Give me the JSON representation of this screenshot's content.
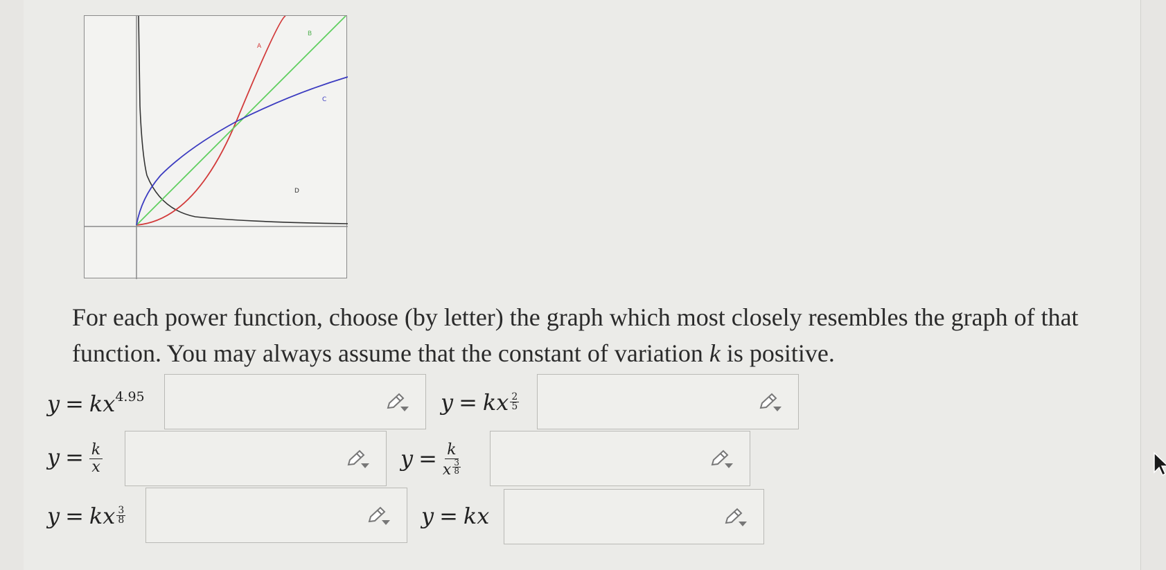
{
  "graph": {
    "curve_labels": [
      "A",
      "B",
      "C",
      "D"
    ],
    "colors": {
      "A": "#d23a3a",
      "B": "#5fcf5f",
      "C": "#3b3bc0",
      "D": "#333333"
    }
  },
  "prompt": {
    "part1": "For each power function, choose (by letter) the graph which most closely resembles the graph of that function. You may always assume that the constant of variation ",
    "k": "k",
    "part2": " is positive."
  },
  "equations": [
    {
      "lhs": "y",
      "eq": "=",
      "k": "k",
      "x": "x",
      "exp": "4.95"
    },
    {
      "lhs": "y",
      "eq": "=",
      "k": "k",
      "x": "x",
      "exp_num": "2",
      "exp_den": "5"
    },
    {
      "lhs": "y",
      "eq": "=",
      "num": "k",
      "den": "x"
    },
    {
      "lhs": "y",
      "eq": "=",
      "num": "k",
      "den": "x",
      "den_exp_num": "3",
      "den_exp_den": "8"
    },
    {
      "lhs": "y",
      "eq": "=",
      "k": "k",
      "x": "x",
      "exp_num": "3",
      "exp_den": "8"
    },
    {
      "lhs": "y",
      "eq": "=",
      "k": "k",
      "x": "x"
    }
  ],
  "answers": [
    "",
    "",
    "",
    "",
    "",
    ""
  ],
  "icons": {
    "edit": "pencil-dropdown-icon"
  }
}
